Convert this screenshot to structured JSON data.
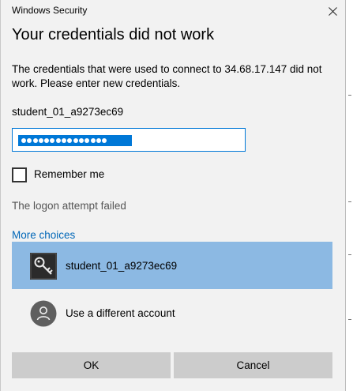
{
  "window": {
    "title": "Windows Security"
  },
  "dialog": {
    "heading": "Your credentials did not work",
    "message": "The credentials that were used to connect to 34.68.17.147 did not work. Please enter new credentials.",
    "username": "student_01_a9273ec69",
    "password": {
      "masked_length": 15,
      "selected": true
    },
    "remember_me": {
      "label": "Remember me",
      "checked": false
    },
    "status": "The logon attempt failed",
    "more_choices": "More choices",
    "accounts": [
      {
        "label": "student_01_a9273ec69",
        "icon": "key-icon",
        "selected": true
      },
      {
        "label": "Use a different account",
        "icon": "user-icon",
        "selected": false
      }
    ],
    "buttons": {
      "ok": "OK",
      "cancel": "Cancel"
    }
  },
  "colors": {
    "dialog_background": "#f2f2f2",
    "accent": "#0078d7",
    "link": "#0067b8",
    "selected_row": "#8cb9e3",
    "button": "#cccccc"
  }
}
